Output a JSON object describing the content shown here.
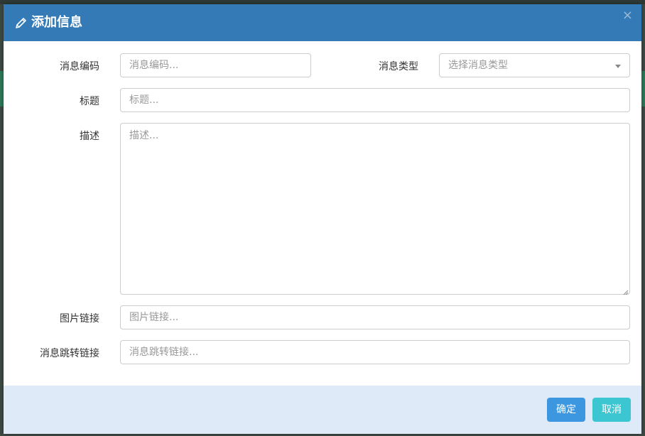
{
  "dialog": {
    "title": "添加信息",
    "close_glyph": "×"
  },
  "form": {
    "code_label": "消息编码",
    "code_placeholder": "消息编码...",
    "type_label": "消息类型",
    "type_placeholder": "选择消息类型",
    "title_label": "标题",
    "title_placeholder": "标题...",
    "desc_label": "描述",
    "desc_placeholder": "描述...",
    "image_label": "图片链接",
    "image_placeholder": "图片链接...",
    "jump_label": "消息跳转链接",
    "jump_placeholder": "消息跳转链接..."
  },
  "footer": {
    "confirm_label": "确定",
    "cancel_label": "取消"
  },
  "colors": {
    "header_bg": "#337ab7",
    "footer_bg": "#deeaf7",
    "confirm_bg": "#3c97e0",
    "cancel_bg": "#3bc6d2"
  },
  "icons": {
    "title_icon": "pencil-icon",
    "select_icon": "caret-down-icon"
  }
}
